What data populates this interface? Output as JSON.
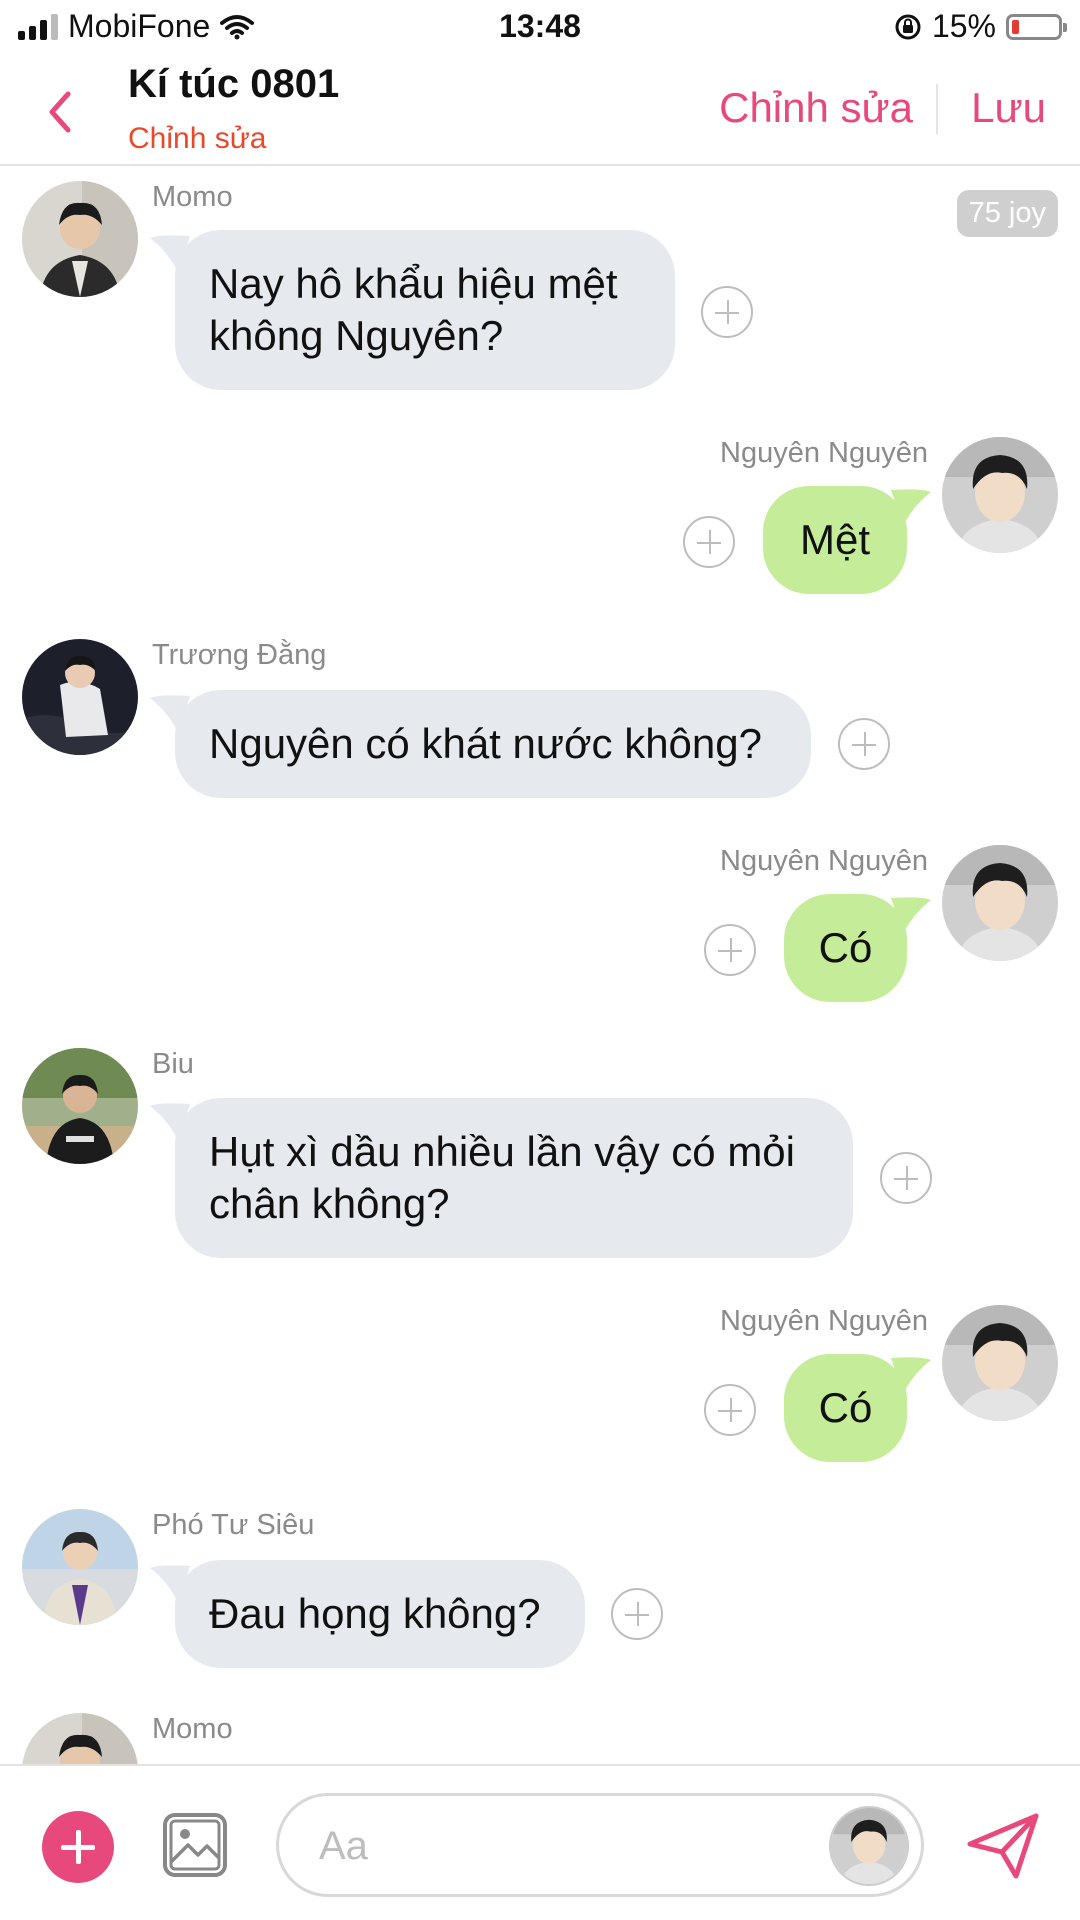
{
  "status_bar": {
    "carrier": "MobiFone",
    "time": "13:48",
    "battery": "15%",
    "battery_level": 0.15,
    "icons": [
      "signal-icon",
      "wifi-icon",
      "rotation-lock-icon",
      "battery-icon"
    ]
  },
  "header": {
    "title": "Kí túc 0801",
    "subtitle": "Chỉnh sửa",
    "edit_label": "Chỉnh sửa",
    "save_label": "Lưu",
    "accent_color": "#e8497d"
  },
  "messages": [
    {
      "sender": "Momo",
      "side": "left",
      "lines": [
        "Nay hô khẩu hiệu mệt",
        "không Nguyên?"
      ],
      "badge": "75 joy"
    },
    {
      "sender": "Nguyên Nguyên",
      "side": "right",
      "lines": [
        "Mệt"
      ]
    },
    {
      "sender": "Trương Đằng",
      "side": "left",
      "lines": [
        "Nguyên có khát nước không?"
      ]
    },
    {
      "sender": "Nguyên Nguyên",
      "side": "right",
      "lines": [
        "Có"
      ]
    },
    {
      "sender": "Biu",
      "side": "left",
      "lines": [
        "Hụt xì dầu nhiều lần vậy có mỏi",
        "chân không?"
      ]
    },
    {
      "sender": "Nguyên Nguyên",
      "side": "right",
      "lines": [
        "Có"
      ]
    },
    {
      "sender": "Phó Tư Siêu",
      "side": "left",
      "lines": [
        "Đau họng không?"
      ]
    },
    {
      "sender": "Momo",
      "side": "left",
      "lines": []
    }
  ],
  "composer": {
    "placeholder": "Aa",
    "icons": [
      "add-icon",
      "image-icon",
      "send-icon"
    ]
  }
}
